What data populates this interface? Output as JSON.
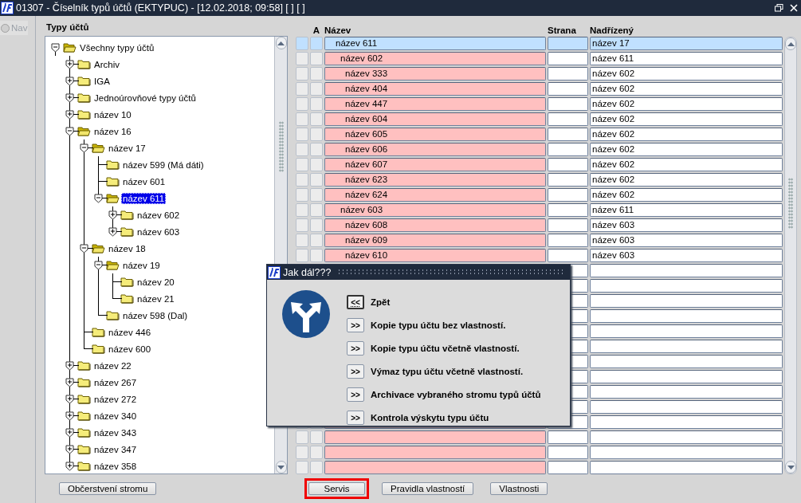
{
  "window": {
    "title": "01307 - Číselník typů účtů (EKTYPUC) - [12.02.2018; 09:58]  [ ]  [ ]"
  },
  "nav": {
    "label": "Nav",
    "checked": false,
    "disabled": true
  },
  "tree": {
    "title": "Typy účtů",
    "items": [
      {
        "label": "Všechny typy účtů",
        "kind": "branch",
        "expanded": true,
        "selected": false,
        "children": [
          {
            "label": "Archiv",
            "kind": "branch",
            "expanded": false,
            "selected": false
          },
          {
            "label": "IGA",
            "kind": "branch",
            "expanded": false,
            "selected": false
          },
          {
            "label": "Jednoúrovňové typy účtů",
            "kind": "branch",
            "expanded": false,
            "selected": false
          },
          {
            "label": "název 10",
            "kind": "branch",
            "expanded": false,
            "selected": false
          },
          {
            "label": "název 16",
            "kind": "branch",
            "expanded": true,
            "selected": false,
            "children": [
              {
                "label": "název 17",
                "kind": "branch",
                "expanded": true,
                "selected": false,
                "children": [
                  {
                    "label": "název 599 (Má dáti)",
                    "kind": "leaf",
                    "selected": false
                  },
                  {
                    "label": "název 601",
                    "kind": "leaf",
                    "selected": false
                  },
                  {
                    "label": "název 611",
                    "kind": "branch",
                    "expanded": true,
                    "selected": true,
                    "children": [
                      {
                        "label": "název 602",
                        "kind": "branch",
                        "expanded": false,
                        "selected": false
                      },
                      {
                        "label": "název 603",
                        "kind": "branch",
                        "expanded": false,
                        "selected": false
                      }
                    ]
                  }
                ]
              },
              {
                "label": "název 18",
                "kind": "branch",
                "expanded": true,
                "selected": false,
                "children": [
                  {
                    "label": "název 19",
                    "kind": "branch",
                    "expanded": true,
                    "selected": false,
                    "children": [
                      {
                        "label": "název 20",
                        "kind": "leaf",
                        "selected": false
                      },
                      {
                        "label": "název 21",
                        "kind": "leaf",
                        "selected": false
                      }
                    ]
                  },
                  {
                    "label": "název 598 (Dal)",
                    "kind": "leaf",
                    "selected": false
                  }
                ]
              },
              {
                "label": "název 446",
                "kind": "leaf",
                "selected": false
              },
              {
                "label": "název 600",
                "kind": "leaf",
                "selected": false
              }
            ]
          },
          {
            "label": "název 22",
            "kind": "branch",
            "expanded": false,
            "selected": false
          },
          {
            "label": "název 267",
            "kind": "branch",
            "expanded": false,
            "selected": false
          },
          {
            "label": "název 272",
            "kind": "branch",
            "expanded": false,
            "selected": false
          },
          {
            "label": "název 340",
            "kind": "branch",
            "expanded": false,
            "selected": false
          },
          {
            "label": "název 343",
            "kind": "branch",
            "expanded": false,
            "selected": false
          },
          {
            "label": "název 347",
            "kind": "branch",
            "expanded": false,
            "selected": false
          },
          {
            "label": "název 358",
            "kind": "branch",
            "expanded": false,
            "selected": false
          }
        ]
      }
    ]
  },
  "tree_buttons": [
    {
      "label": "Občerstvení stromu",
      "highlighted": false
    }
  ],
  "table": {
    "columns": [
      "A",
      "Název",
      "Strana",
      "Nadřízený"
    ],
    "rows": [
      {
        "name": "název 611",
        "parent": "název 17",
        "selected": true,
        "children": [
          {
            "name": "název 602",
            "parent": "název 611",
            "selected": false,
            "children": [
              {
                "name": "název 333",
                "parent": "název 602",
                "selected": false
              },
              {
                "name": "název 404",
                "parent": "název 602",
                "selected": false
              },
              {
                "name": "název 447",
                "parent": "název 602",
                "selected": false
              },
              {
                "name": "název 604",
                "parent": "název 602",
                "selected": false
              },
              {
                "name": "název 605",
                "parent": "název 602",
                "selected": false
              },
              {
                "name": "název 606",
                "parent": "název 602",
                "selected": false
              },
              {
                "name": "název 607",
                "parent": "název 602",
                "selected": false
              },
              {
                "name": "název 623",
                "parent": "název 602",
                "selected": false
              },
              {
                "name": "název 624",
                "parent": "název 602",
                "selected": false
              }
            ]
          },
          {
            "name": "název 603",
            "parent": "název 611",
            "selected": false,
            "children": [
              {
                "name": "název 608",
                "parent": "název 603",
                "selected": false
              },
              {
                "name": "název 609",
                "parent": "název 603",
                "selected": false
              },
              {
                "name": "název 610",
                "parent": "název 603",
                "selected": false
              }
            ]
          }
        ]
      }
    ]
  },
  "table_buttons": [
    {
      "label": "Servis",
      "highlighted": true
    },
    {
      "label": "Pravidla vlastností",
      "highlighted": false
    },
    {
      "label": "Vlastnosti",
      "highlighted": false
    }
  ],
  "dialog": {
    "title": "Jak dál???",
    "options": [
      {
        "button": "<<",
        "label": "Zpět",
        "focused": true
      },
      {
        "button": ">>",
        "label": "Kopie typu účtu bez vlastností.",
        "focused": false
      },
      {
        "button": ">>",
        "label": "Kopie typu účtu včetně vlastností.",
        "focused": false
      },
      {
        "button": ">>",
        "label": "Výmaz typu účtu včetně vlastností.",
        "focused": false
      },
      {
        "button": ">>",
        "label": "Archivace vybraného stromu typů účtů",
        "focused": false
      },
      {
        "button": ">>",
        "label": "Kontrola výskytu typu účtu",
        "focused": false
      }
    ]
  }
}
